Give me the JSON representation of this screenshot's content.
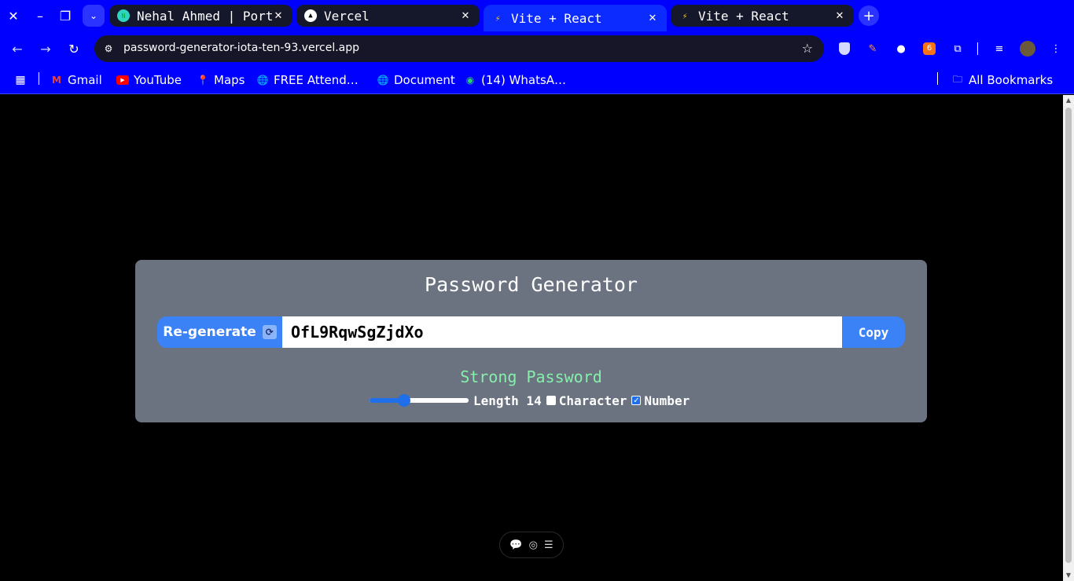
{
  "browser": {
    "tabs": [
      {
        "title": "Nehal Ahmed | Portf",
        "favicon": "portfolio-favicon",
        "active": false
      },
      {
        "title": "Vercel",
        "favicon": "vercel-favicon",
        "active": false
      },
      {
        "title": "Vite + React",
        "favicon": "vite-favicon",
        "active": true
      },
      {
        "title": "Vite + React",
        "favicon": "vite-favicon",
        "active": false
      }
    ],
    "url": "password-generator-iota-ten-93.vercel.app",
    "bookmarks": [
      {
        "label": "Gmail",
        "icon": "gmail-icon"
      },
      {
        "label": "YouTube",
        "icon": "youtube-icon"
      },
      {
        "label": "Maps",
        "icon": "maps-icon"
      },
      {
        "label": "FREE Attend…",
        "icon": "globe-icon"
      },
      {
        "label": "Document",
        "icon": "globe-icon"
      },
      {
        "label": "(14) WhatsA…",
        "icon": "whatsapp-icon"
      }
    ],
    "all_bookmarks": "All Bookmarks",
    "colors": {
      "chrome_bg": "#0000ff",
      "tab_inactive": "#15172a"
    }
  },
  "app": {
    "title": "Password Generator",
    "regenerate_label": "Re-generate",
    "regenerate_emoji": "🔃",
    "password": "OfL9RqwSgZjdXo",
    "copy_label": "Copy",
    "strength": "Strong Password",
    "length_label": "Length 14",
    "length_value": 14,
    "length_fraction": 0.35,
    "character_label": "Character",
    "character_checked": false,
    "number_label": "Number",
    "number_checked": true,
    "colors": {
      "card_bg": "#6b7280",
      "button_bg": "#3b82f6",
      "strength_text": "#86efac"
    }
  }
}
